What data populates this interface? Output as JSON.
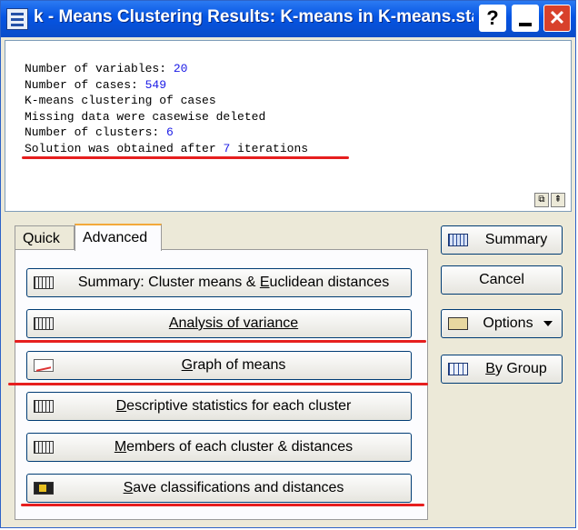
{
  "window": {
    "title": "k - Means Clustering Results: K-means in K-means.sta",
    "help_glyph": "?",
    "close_glyph": "✕"
  },
  "output": {
    "lines": [
      {
        "label": "Number of variables: ",
        "value": "20"
      },
      {
        "label": "Number of cases: ",
        "value": "549"
      },
      {
        "label": "K-means clustering of cases",
        "value": ""
      },
      {
        "label": "Missing data were casewise deleted",
        "value": ""
      },
      {
        "label": "Number of clusters: ",
        "value": "6"
      },
      {
        "label": "Solution was obtained after ",
        "value": "7",
        "suffix": " iterations"
      }
    ],
    "copy_icon": "copy-icon",
    "expand_glyph": "⇞"
  },
  "tabs": [
    {
      "label": "Quick",
      "selected": false
    },
    {
      "label": "Advanced",
      "selected": true
    }
  ],
  "advanced_buttons": [
    {
      "pre": "Summary: Cluster means & ",
      "key": "E",
      "post": "uclidean distances",
      "icon": "table-icon"
    },
    {
      "pre": "",
      "key": "A",
      "post": "nalysis of variance",
      "icon": "table-icon"
    },
    {
      "pre": "",
      "key": "G",
      "post": "raph of means",
      "icon": "line-graph-icon"
    },
    {
      "pre": "",
      "key": "D",
      "post": "escriptive statistics for each cluster",
      "icon": "table-icon"
    },
    {
      "pre": "",
      "key": "M",
      "post": "embers of each cluster & distances",
      "icon": "table-icon"
    },
    {
      "pre": "",
      "key": "S",
      "post": "ave classifications and distances",
      "icon": "save-icon"
    }
  ],
  "side_buttons": {
    "summary": "Summary",
    "cancel": "Cancel",
    "options": "Options",
    "by_group_key": "B",
    "by_group_rest": "y Group"
  },
  "colors": {
    "title_bar": "#0554e3",
    "number_highlight": "#1a1ae6",
    "annotation_underline": "#e61e1e"
  }
}
